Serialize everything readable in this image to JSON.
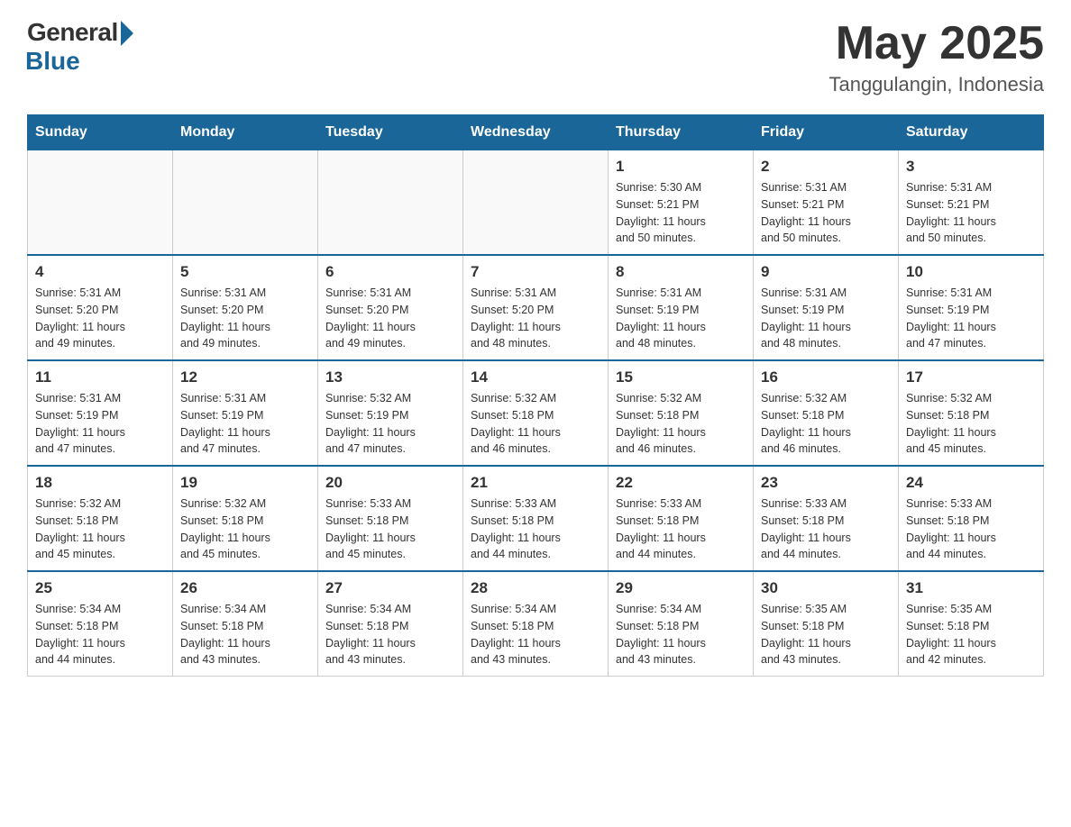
{
  "header": {
    "logo_general": "General",
    "logo_blue": "Blue",
    "title": "May 2025",
    "location": "Tanggulangin, Indonesia"
  },
  "days_of_week": [
    "Sunday",
    "Monday",
    "Tuesday",
    "Wednesday",
    "Thursday",
    "Friday",
    "Saturday"
  ],
  "weeks": [
    {
      "cells": [
        {
          "day": "",
          "info": ""
        },
        {
          "day": "",
          "info": ""
        },
        {
          "day": "",
          "info": ""
        },
        {
          "day": "",
          "info": ""
        },
        {
          "day": "1",
          "info": "Sunrise: 5:30 AM\nSunset: 5:21 PM\nDaylight: 11 hours\nand 50 minutes."
        },
        {
          "day": "2",
          "info": "Sunrise: 5:31 AM\nSunset: 5:21 PM\nDaylight: 11 hours\nand 50 minutes."
        },
        {
          "day": "3",
          "info": "Sunrise: 5:31 AM\nSunset: 5:21 PM\nDaylight: 11 hours\nand 50 minutes."
        }
      ]
    },
    {
      "cells": [
        {
          "day": "4",
          "info": "Sunrise: 5:31 AM\nSunset: 5:20 PM\nDaylight: 11 hours\nand 49 minutes."
        },
        {
          "day": "5",
          "info": "Sunrise: 5:31 AM\nSunset: 5:20 PM\nDaylight: 11 hours\nand 49 minutes."
        },
        {
          "day": "6",
          "info": "Sunrise: 5:31 AM\nSunset: 5:20 PM\nDaylight: 11 hours\nand 49 minutes."
        },
        {
          "day": "7",
          "info": "Sunrise: 5:31 AM\nSunset: 5:20 PM\nDaylight: 11 hours\nand 48 minutes."
        },
        {
          "day": "8",
          "info": "Sunrise: 5:31 AM\nSunset: 5:19 PM\nDaylight: 11 hours\nand 48 minutes."
        },
        {
          "day": "9",
          "info": "Sunrise: 5:31 AM\nSunset: 5:19 PM\nDaylight: 11 hours\nand 48 minutes."
        },
        {
          "day": "10",
          "info": "Sunrise: 5:31 AM\nSunset: 5:19 PM\nDaylight: 11 hours\nand 47 minutes."
        }
      ]
    },
    {
      "cells": [
        {
          "day": "11",
          "info": "Sunrise: 5:31 AM\nSunset: 5:19 PM\nDaylight: 11 hours\nand 47 minutes."
        },
        {
          "day": "12",
          "info": "Sunrise: 5:31 AM\nSunset: 5:19 PM\nDaylight: 11 hours\nand 47 minutes."
        },
        {
          "day": "13",
          "info": "Sunrise: 5:32 AM\nSunset: 5:19 PM\nDaylight: 11 hours\nand 47 minutes."
        },
        {
          "day": "14",
          "info": "Sunrise: 5:32 AM\nSunset: 5:18 PM\nDaylight: 11 hours\nand 46 minutes."
        },
        {
          "day": "15",
          "info": "Sunrise: 5:32 AM\nSunset: 5:18 PM\nDaylight: 11 hours\nand 46 minutes."
        },
        {
          "day": "16",
          "info": "Sunrise: 5:32 AM\nSunset: 5:18 PM\nDaylight: 11 hours\nand 46 minutes."
        },
        {
          "day": "17",
          "info": "Sunrise: 5:32 AM\nSunset: 5:18 PM\nDaylight: 11 hours\nand 45 minutes."
        }
      ]
    },
    {
      "cells": [
        {
          "day": "18",
          "info": "Sunrise: 5:32 AM\nSunset: 5:18 PM\nDaylight: 11 hours\nand 45 minutes."
        },
        {
          "day": "19",
          "info": "Sunrise: 5:32 AM\nSunset: 5:18 PM\nDaylight: 11 hours\nand 45 minutes."
        },
        {
          "day": "20",
          "info": "Sunrise: 5:33 AM\nSunset: 5:18 PM\nDaylight: 11 hours\nand 45 minutes."
        },
        {
          "day": "21",
          "info": "Sunrise: 5:33 AM\nSunset: 5:18 PM\nDaylight: 11 hours\nand 44 minutes."
        },
        {
          "day": "22",
          "info": "Sunrise: 5:33 AM\nSunset: 5:18 PM\nDaylight: 11 hours\nand 44 minutes."
        },
        {
          "day": "23",
          "info": "Sunrise: 5:33 AM\nSunset: 5:18 PM\nDaylight: 11 hours\nand 44 minutes."
        },
        {
          "day": "24",
          "info": "Sunrise: 5:33 AM\nSunset: 5:18 PM\nDaylight: 11 hours\nand 44 minutes."
        }
      ]
    },
    {
      "cells": [
        {
          "day": "25",
          "info": "Sunrise: 5:34 AM\nSunset: 5:18 PM\nDaylight: 11 hours\nand 44 minutes."
        },
        {
          "day": "26",
          "info": "Sunrise: 5:34 AM\nSunset: 5:18 PM\nDaylight: 11 hours\nand 43 minutes."
        },
        {
          "day": "27",
          "info": "Sunrise: 5:34 AM\nSunset: 5:18 PM\nDaylight: 11 hours\nand 43 minutes."
        },
        {
          "day": "28",
          "info": "Sunrise: 5:34 AM\nSunset: 5:18 PM\nDaylight: 11 hours\nand 43 minutes."
        },
        {
          "day": "29",
          "info": "Sunrise: 5:34 AM\nSunset: 5:18 PM\nDaylight: 11 hours\nand 43 minutes."
        },
        {
          "day": "30",
          "info": "Sunrise: 5:35 AM\nSunset: 5:18 PM\nDaylight: 11 hours\nand 43 minutes."
        },
        {
          "day": "31",
          "info": "Sunrise: 5:35 AM\nSunset: 5:18 PM\nDaylight: 11 hours\nand 42 minutes."
        }
      ]
    }
  ]
}
